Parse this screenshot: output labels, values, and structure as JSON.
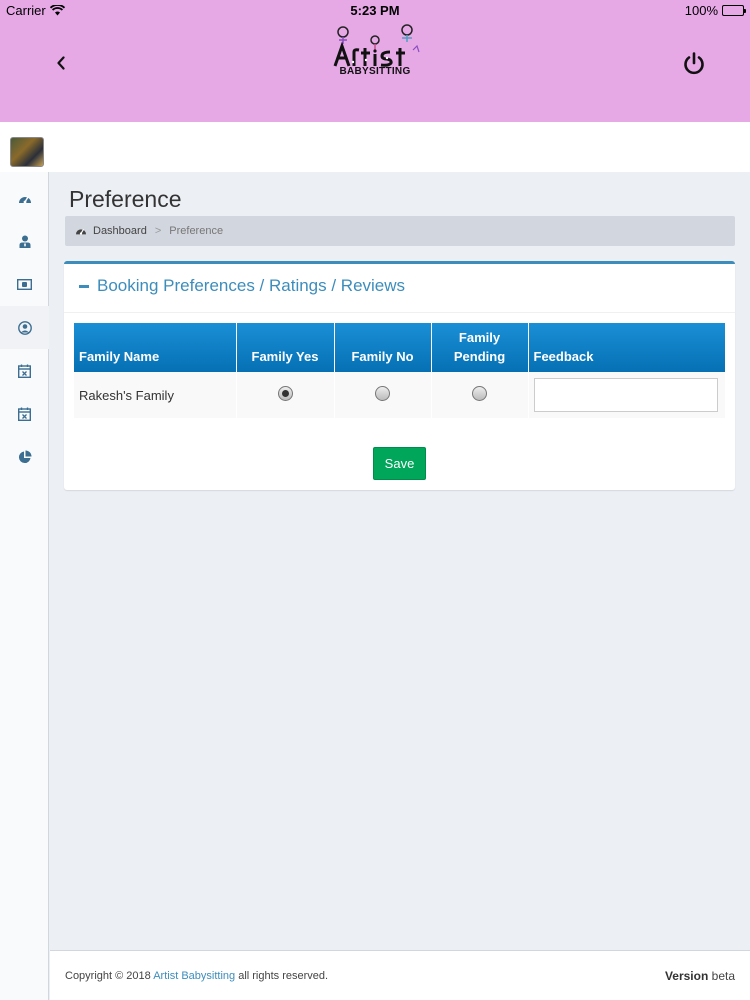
{
  "status_bar": {
    "carrier": "Carrier",
    "time": "5:23 PM",
    "battery": "100%"
  },
  "header": {
    "logo_text": "BABYSITTING",
    "background": "#e6a9e6"
  },
  "sidebar": {
    "items": [
      {
        "icon": "dashboard-icon"
      },
      {
        "icon": "user-tie-icon"
      },
      {
        "icon": "money-icon"
      },
      {
        "icon": "user-circle-icon",
        "active": true
      },
      {
        "icon": "calendar-x-icon"
      },
      {
        "icon": "calendar-x-icon"
      },
      {
        "icon": "pie-chart-icon"
      }
    ]
  },
  "page": {
    "title": "Preference",
    "breadcrumb": {
      "home": "Dashboard",
      "separator": ">",
      "current": "Preference"
    }
  },
  "box": {
    "title": "Booking Preferences / Ratings / Reviews",
    "accent": "#3c8dbc",
    "table": {
      "headers": [
        "Family Name",
        "Family Yes",
        "Family No",
        "Family Pending",
        "Feedback"
      ],
      "header_lines": [
        [
          "Family Name"
        ],
        [
          "Family Yes"
        ],
        [
          "Family No"
        ],
        [
          "Family",
          "Pending"
        ],
        [
          "Feedback"
        ]
      ],
      "rows": [
        {
          "family_name": "Rakesh's Family",
          "selected": "Family Yes",
          "feedback": ""
        }
      ]
    },
    "save_label": "Save",
    "save_color": "#00a65a"
  },
  "footer": {
    "copyright_prefix": "Copyright © 2018",
    "brand_link": "Artist Babysitting",
    "copyright_suffix": "all rights reserved.",
    "version_label": "Version",
    "version_value": "beta"
  }
}
